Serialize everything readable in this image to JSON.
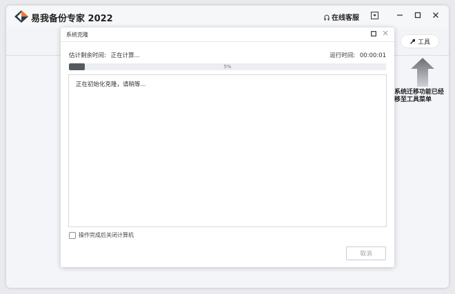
{
  "app": {
    "title": "易我备份专家 2022",
    "online_service": "在线客服"
  },
  "toolbar": {
    "tools_label": "工具"
  },
  "background": {
    "migrate_text": "系统迁移功能已经移至工具菜单"
  },
  "dialog": {
    "title": "系统克隆",
    "estimated_label": "估计剩余时间:",
    "estimated_value": "正在计算...",
    "runtime_label": "运行时间:",
    "runtime_value": "00:00:01",
    "progress_percent": 5,
    "progress_text": "5%",
    "log_lines": [
      "正在初始化克隆，请稍等..."
    ],
    "shutdown_label": "操作完成后关闭计算机",
    "shutdown_checked": false,
    "cancel_label": "取消"
  },
  "colors": {
    "accent_orange": "#f07a2a",
    "logo_dark": "#2d3a4a",
    "progress_fill": "#555a60"
  },
  "icons": {
    "logo": "easeus-logo-icon",
    "service": "headset-icon",
    "dropdown": "dropdown-icon",
    "minimize": "minimize-icon",
    "maximize": "maximize-icon",
    "close": "close-icon",
    "tools": "wrench-icon",
    "arrow": "arrow-up-icon"
  }
}
